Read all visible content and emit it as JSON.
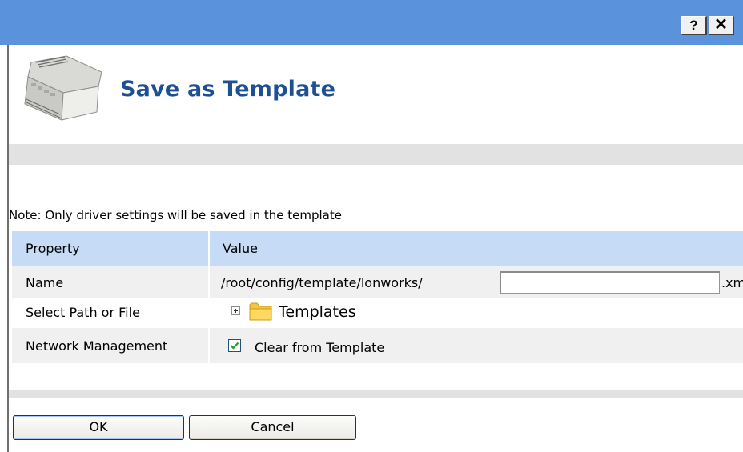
{
  "titlebar": {
    "help_label": "?",
    "close_label": "✕"
  },
  "dialog": {
    "title": "Save as Template",
    "note": "Note: Only driver settings will be saved in the template"
  },
  "table": {
    "header": {
      "property": "Property",
      "value": "Value"
    },
    "name_row": {
      "label": "Name",
      "prefix": "/root/config/template/lonworks/",
      "input_value": "",
      "suffix": ".xm"
    },
    "path_row": {
      "label": "Select Path or File",
      "folder_label": "Templates"
    },
    "network_row": {
      "label": "Network Management",
      "checkbox_checked": true,
      "checkbox_label": "Clear from Template"
    }
  },
  "buttons": {
    "ok": "OK",
    "cancel": "Cancel"
  },
  "colors": {
    "titlebar": "#5a93dc",
    "title_text": "#1d4f93",
    "table_header": "#c5dbf6",
    "row_alt": "#f0f0f0",
    "band": "#e2e2e2",
    "check": "#21a121"
  }
}
